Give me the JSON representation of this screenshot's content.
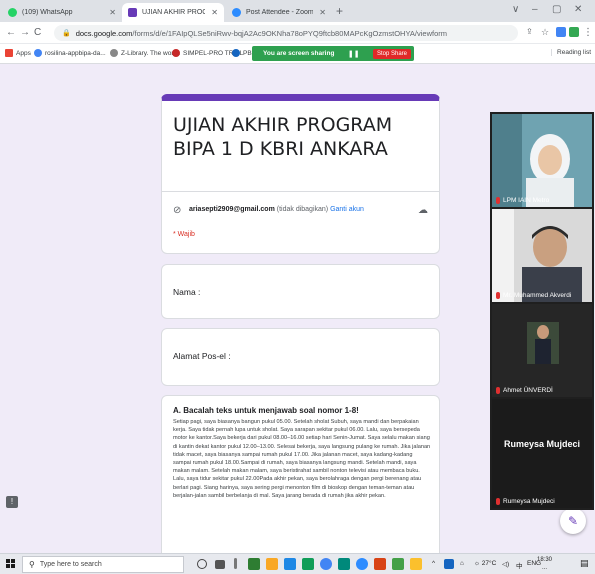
{
  "browser": {
    "tabs": [
      {
        "title": "(109) WhatsApp",
        "favicon": "whatsapp-icon",
        "color": "#25d366",
        "active": false
      },
      {
        "title": "UJIAN AKHIR PROGRAM BIPA 1 [",
        "favicon": "google-forms-icon",
        "color": "#673ab7",
        "active": true
      },
      {
        "title": "Post Attendee - Zoom",
        "favicon": "zoom-icon",
        "color": "#2d8cff",
        "active": false
      }
    ],
    "new_tab": "+",
    "window_controls": [
      "∨",
      "–",
      "▢",
      "✕"
    ],
    "url_host": "docs.google.com",
    "url_path": "/forms/d/e/1FAIpQLSe5niRwv-bqjA2Ac9OKNha78oPYQ9ftcb80MAPcKgOzmstOHYA/viewform"
  },
  "bookmarks": {
    "items": [
      {
        "label": "Apps",
        "color": "#ea4335"
      },
      {
        "label": "rosilina-appbipa-da...",
        "color": "#4285f4"
      },
      {
        "label": "Z-Library. The worl...",
        "color": "#888888"
      },
      {
        "label": "SIMPEL-PRO TRIAL",
        "color": "#c62828"
      },
      {
        "label": "PBG",
        "color": "#1565c0"
      }
    ],
    "sharing_text": "You are screen sharing",
    "stop_share": "Stop Share",
    "reading_list": "Reading list"
  },
  "form": {
    "title": "UJIAN AKHIR PROGRAM BIPA 1 D KBRI ANKARA",
    "account_email": "ariasepti2909@gmail.com",
    "account_note": " (tidak dibagikan) ",
    "switch_account": "Ganti akun",
    "required_note": "* Wajib",
    "q_name": "Nama :",
    "q_email": "Alamat Pos-el :",
    "reading_title": "A. Bacalah teks untuk menjawab soal nomor 1-8!",
    "reading_text": "Setiap pagi, saya biasanya bangun pukul 05.00. Setelah sholat Subuh, saya mandi dan berpakaian kerja. Saya tidak pernah lupa untuk sholat. Saya sarapan sekitar pukul 06.00. Lalu, saya bersepeda motor ke kantor.Saya bekerja dari pukul 08.00–16.00 setiap hari Senin-Jumat. Saya selalu makan siang di kantin dekat kantor pukul 12.00–13.00. Selesai bekerja, saya langsung pulang ke rumah. Jika jalanan tidak macet, saya biasanya sampai rumah pukul 17.00. Jika jalanan macet, saya kadang-kadang sampai rumah pukul 18.00.Sampai di rumah, saya biasanya langsung mandi. Setelah mandi, saya makan malam. Setelah makan malam, saya beristirahat sambil nonton televisi atau membaca buku. Lalu, saya tidur sekitar pukul 22.00Pada akhir pekan, saya berolahraga dengan pergi berenang atau berlari pagi. Siang harinya, saya sering pergi menonton film di bioskop dengan teman-teman atau berjalan-jalan sambil berbelanja di mal. Saya jarang berada di rumah jika akhir pekan."
  },
  "zoom": {
    "participants": [
      {
        "name": "LPM IAIN Metro"
      },
      {
        "name": "Mr. Muhammed Akverdi"
      },
      {
        "name": "Ahmet ÜNVERDİ"
      },
      {
        "name": "Rumeysa Mujdeci",
        "display": "Rumeysa Mujdeci"
      }
    ]
  },
  "taskbar": {
    "search_placeholder": "Type here to search",
    "weather": "27°C",
    "language": "ENG",
    "time": "18:30",
    "date": "..."
  }
}
